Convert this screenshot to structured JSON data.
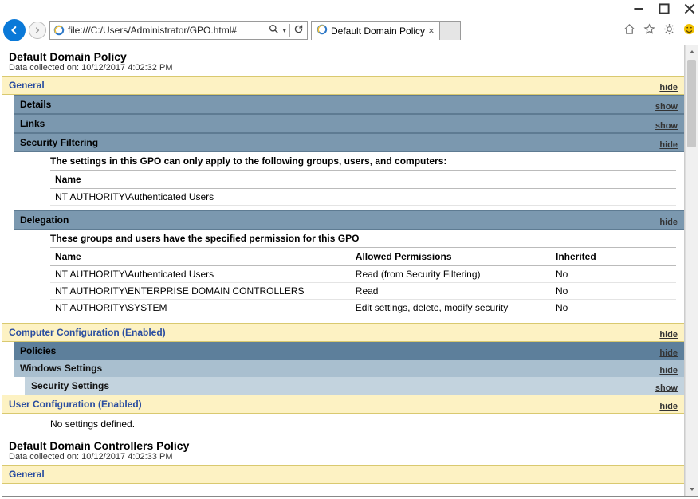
{
  "browser": {
    "url": "file:///C:/Users/Administrator/GPO.html#",
    "tab_title": "Default Domain Policy"
  },
  "report1": {
    "title": "Default Domain Policy",
    "collected": "Data collected on: 10/12/2017 4:02:32 PM",
    "general_label": "General",
    "details_label": "Details",
    "links_label": "Links",
    "secfilter_label": "Security Filtering",
    "secfilter_caption": "The settings in this GPO can only apply to the following groups, users, and computers:",
    "secfilter_header_name": "Name",
    "secfilter_row0": "NT AUTHORITY\\Authenticated Users",
    "delegation_label": "Delegation",
    "delegation_caption": "These groups and users have the specified permission for this GPO",
    "delegation_headers": {
      "name": "Name",
      "perm": "Allowed Permissions",
      "inh": "Inherited"
    },
    "delegation_rows": {
      "r0": {
        "name": "NT AUTHORITY\\Authenticated Users",
        "perm": "Read (from Security Filtering)",
        "inh": "No"
      },
      "r1": {
        "name": "NT AUTHORITY\\ENTERPRISE DOMAIN CONTROLLERS",
        "perm": "Read",
        "inh": "No"
      },
      "r2": {
        "name": "NT AUTHORITY\\SYSTEM",
        "perm": "Edit settings, delete, modify security",
        "inh": "No"
      }
    },
    "compconf_label": "Computer Configuration (Enabled)",
    "policies_label": "Policies",
    "winsettings_label": "Windows Settings",
    "secsettings_label": "Security Settings",
    "userconf_label": "User Configuration (Enabled)",
    "nosettings": "No settings defined."
  },
  "report2": {
    "title": "Default Domain Controllers Policy",
    "collected": "Data collected on: 10/12/2017 4:02:33 PM",
    "general_label": "General"
  },
  "toggles": {
    "hide": "hide",
    "show": "show"
  }
}
